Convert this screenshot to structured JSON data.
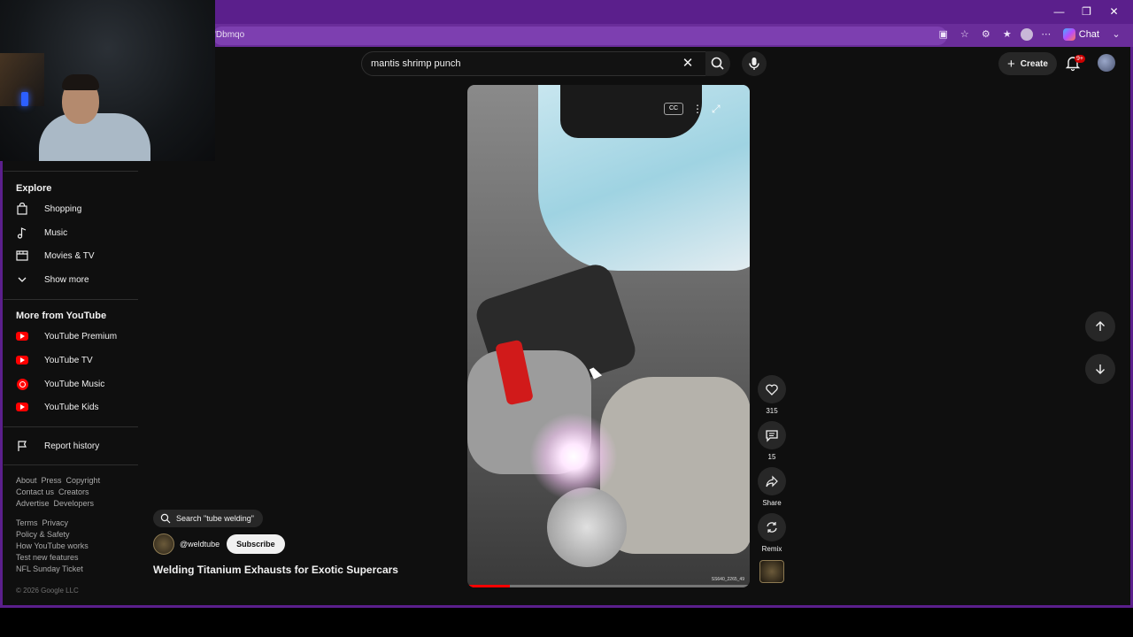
{
  "browser": {
    "url_fragment": "'Dbmqo",
    "chat_label": "Chat",
    "window_controls": [
      "minimize-icon",
      "restore-icon",
      "close-icon"
    ]
  },
  "header": {
    "search_query": "mantis shrimp punch",
    "create_label": "Create",
    "notification_count": "9+"
  },
  "sidebar": {
    "explore_title": "Explore",
    "explore_items": [
      {
        "label": "Shopping",
        "icon": "shopping-bag-icon"
      },
      {
        "label": "Music",
        "icon": "music-note-icon"
      },
      {
        "label": "Movies & TV",
        "icon": "film-icon"
      },
      {
        "label": "Show more",
        "icon": "chevron-down-icon"
      }
    ],
    "more_title": "More from YouTube",
    "more_items": [
      {
        "label": "YouTube Premium",
        "icon": "youtube-premium-icon"
      },
      {
        "label": "YouTube TV",
        "icon": "youtube-tv-icon"
      },
      {
        "label": "YouTube Music",
        "icon": "youtube-music-icon"
      },
      {
        "label": "YouTube Kids",
        "icon": "youtube-kids-icon"
      }
    ],
    "report_history": "Report history",
    "footer_row1": [
      "About",
      "Press",
      "Copyright"
    ],
    "footer_row2": [
      "Contact us",
      "Creators"
    ],
    "footer_row3": [
      "Advertise",
      "Developers"
    ],
    "footer_row4": [
      "Terms",
      "Privacy"
    ],
    "footer_row5": [
      "Policy & Safety"
    ],
    "footer_row6": [
      "How YouTube works"
    ],
    "footer_row7": [
      "Test new features"
    ],
    "footer_row8": [
      "NFL Sunday Ticket"
    ],
    "copyright": "© 2026 Google LLC"
  },
  "short": {
    "search_chip": "Search \"tube welding\"",
    "channel": "@weldtube",
    "subscribe_label": "Subscribe",
    "title": "Welding Titanium Exhausts for Exotic Supercars",
    "likes": "315",
    "comments": "15",
    "share_label": "Share",
    "remix_label": "Remix",
    "watermark": "SS640_2265_49",
    "progress": 0.15
  },
  "colors": {
    "browser_accent": "#5b1f8c",
    "youtube_red": "#ff0000",
    "page_bg": "#0f0f0f"
  }
}
